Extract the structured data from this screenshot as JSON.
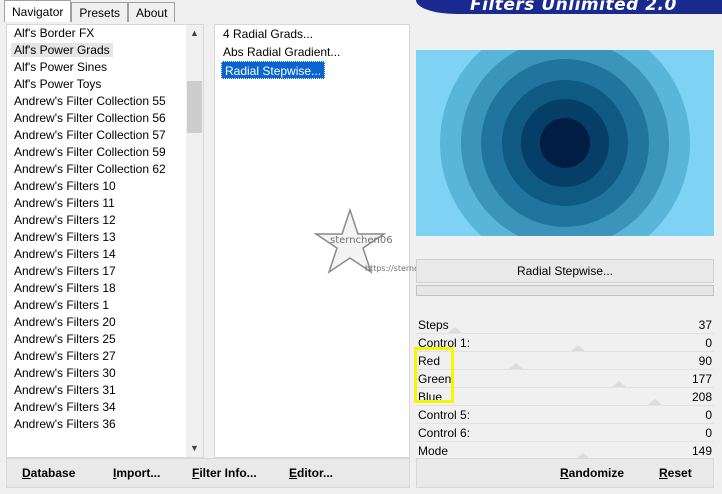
{
  "tabs": [
    "Navigator",
    "Presets",
    "About"
  ],
  "banner_title": "Filters Unlimited 2.0",
  "categories": [
    "Alf's Border FX",
    "Alf's Power Grads",
    "Alf's Power Sines",
    "Alf's Power Toys",
    "Andrew's Filter Collection 55",
    "Andrew's Filter Collection 56",
    "Andrew's Filter Collection 57",
    "Andrew's Filter Collection 59",
    "Andrew's Filter Collection 62",
    "Andrew's Filters 10",
    "Andrew's Filters 11",
    "Andrew's Filters 12",
    "Andrew's Filters 13",
    "Andrew's Filters 14",
    "Andrew's Filters 17",
    "Andrew's Filters 18",
    "Andrew's Filters 1",
    "Andrew's Filters 20",
    "Andrew's Filters 25",
    "Andrew's Filters 27",
    "Andrew's Filters 30",
    "Andrew's Filters 31",
    "Andrew's Filters 34",
    "Andrew's Filters 36"
  ],
  "selected_category": "Alf's Power Grads",
  "filters": [
    "4 Radial Grads...",
    "Abs Radial Gradient...",
    "Radial Stepwise..."
  ],
  "selected_filter": "Radial Stepwise...",
  "filter_button_label": "Radial Stepwise...",
  "watermark_text": "sternchen06",
  "watermark_url": "https://sternchenstutorialstuedchen.de/",
  "params": [
    {
      "label": "Steps",
      "value": "37"
    },
    {
      "label": "Control 1:",
      "value": "0"
    },
    {
      "label": "Red",
      "value": "90"
    },
    {
      "label": "Green",
      "value": "177"
    },
    {
      "label": "Blue",
      "value": "208"
    },
    {
      "label": "Control 5:",
      "value": "0"
    },
    {
      "label": "Control 6:",
      "value": "0"
    },
    {
      "label": "Mode",
      "value": "149"
    }
  ],
  "buttons": {
    "database": "Database",
    "import": "Import...",
    "filter_info": "Filter Info...",
    "editor": "Editor...",
    "randomize": "Randomize",
    "reset": "Reset"
  },
  "colors": {
    "preview_rings": [
      "#7ed3f4",
      "#5ab6d8",
      "#3b95bb",
      "#20759e",
      "#0e5a82",
      "#053e66",
      "#011d43",
      "#000a26"
    ],
    "selection": "#0a64d0",
    "highlight": "#f6f600",
    "banner": "#1a2a8f"
  }
}
